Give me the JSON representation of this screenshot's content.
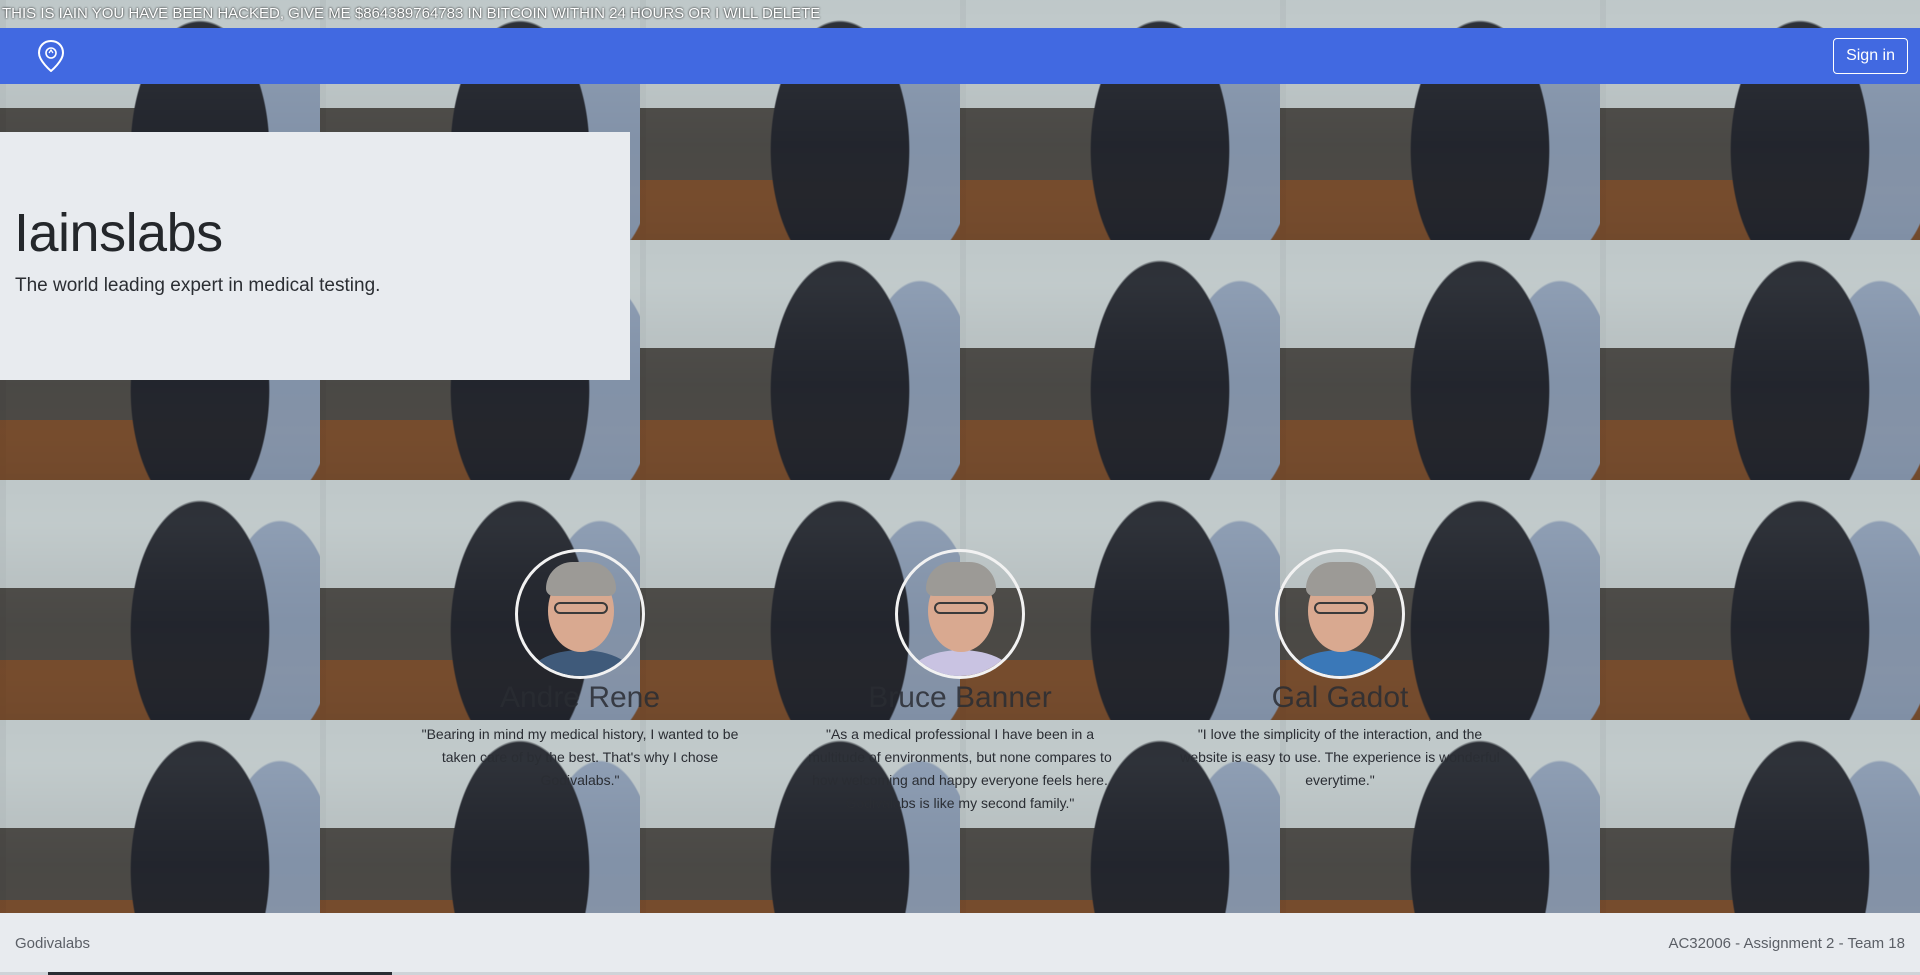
{
  "banner": {
    "text": "THIS IS IAIN YOU HAVE BEEN HACKED, GIVE ME $864389764783 IN BITCOIN WITHIN 24 HOURS OR I WILL DELETE"
  },
  "navbar": {
    "logo_icon": "map-pin-logo-icon",
    "signin_label": "Sign in",
    "brand_color": "#4169e1"
  },
  "hero": {
    "title": "Iainslabs",
    "subtitle": "The world leading expert in medical testing."
  },
  "testimonials": [
    {
      "name": "Andre Rene",
      "quote": "\"Bearing in mind my medical history, I wanted to be taken care of by the best. That's why I chose Godivalabs.\"",
      "shirt_color": "#3f5a7a"
    },
    {
      "name": "Bruce Banner",
      "quote": "\"As a medical professional I have been in a multitude of environments, but none compares to how welcoming and happy everyone feels here. Godivalabs is like my second family.\"",
      "shirt_color": "#c9c3e2"
    },
    {
      "name": "Gal Gadot",
      "quote": "\"I love the simplicity of the interaction, and the website is easy to use. The experience is wonderful everytime.\"",
      "shirt_color": "#3a78b8"
    }
  ],
  "footer": {
    "left_text": "Godivalabs",
    "right_text": "AC32006 - Assignment 2 - Team 18"
  }
}
